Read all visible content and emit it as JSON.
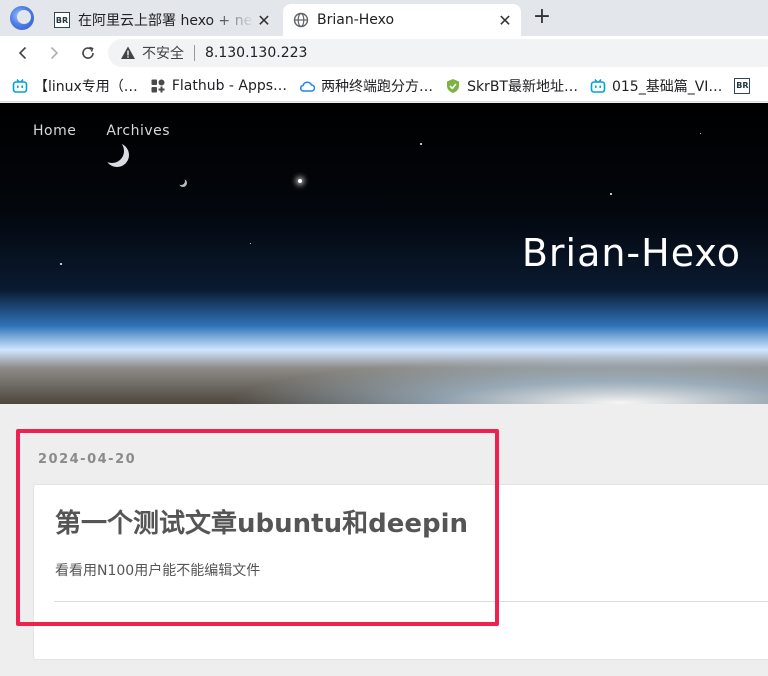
{
  "browser": {
    "tabs": [
      {
        "label": "在阿里云上部署 hexo + next",
        "favicon": "br-logo-icon",
        "active": false
      },
      {
        "label": "Brian-Hexo",
        "favicon": "globe-icon",
        "active": true
      }
    ],
    "address_bar": {
      "security_label": "不安全",
      "url": "8.130.130.223"
    },
    "bookmarks": [
      {
        "label": "【linux专用（…",
        "icon": "bilibili-icon"
      },
      {
        "label": "Flathub - Apps…",
        "icon": "flathub-icon"
      },
      {
        "label": "两种终端跑分方…",
        "icon": "cloud-icon"
      },
      {
        "label": "SkrBT最新地址…",
        "icon": "shield-icon"
      },
      {
        "label": "015_基础篇_VI…",
        "icon": "bilibili-icon"
      },
      {
        "label": "BR",
        "icon": "br-logo-icon"
      }
    ]
  },
  "page": {
    "nav": [
      {
        "label": "Home"
      },
      {
        "label": "Archives"
      }
    ],
    "site_title": "Brian-Hexo",
    "post": {
      "date": "2024-04-20",
      "title": "第一个测试文章ubuntu和deepin",
      "excerpt": "看看用N100用户能不能编辑文件"
    }
  },
  "colors": {
    "highlight": "#ee2150",
    "tab_strip": "#e3e6ea",
    "page_bg": "#eeeeee"
  }
}
